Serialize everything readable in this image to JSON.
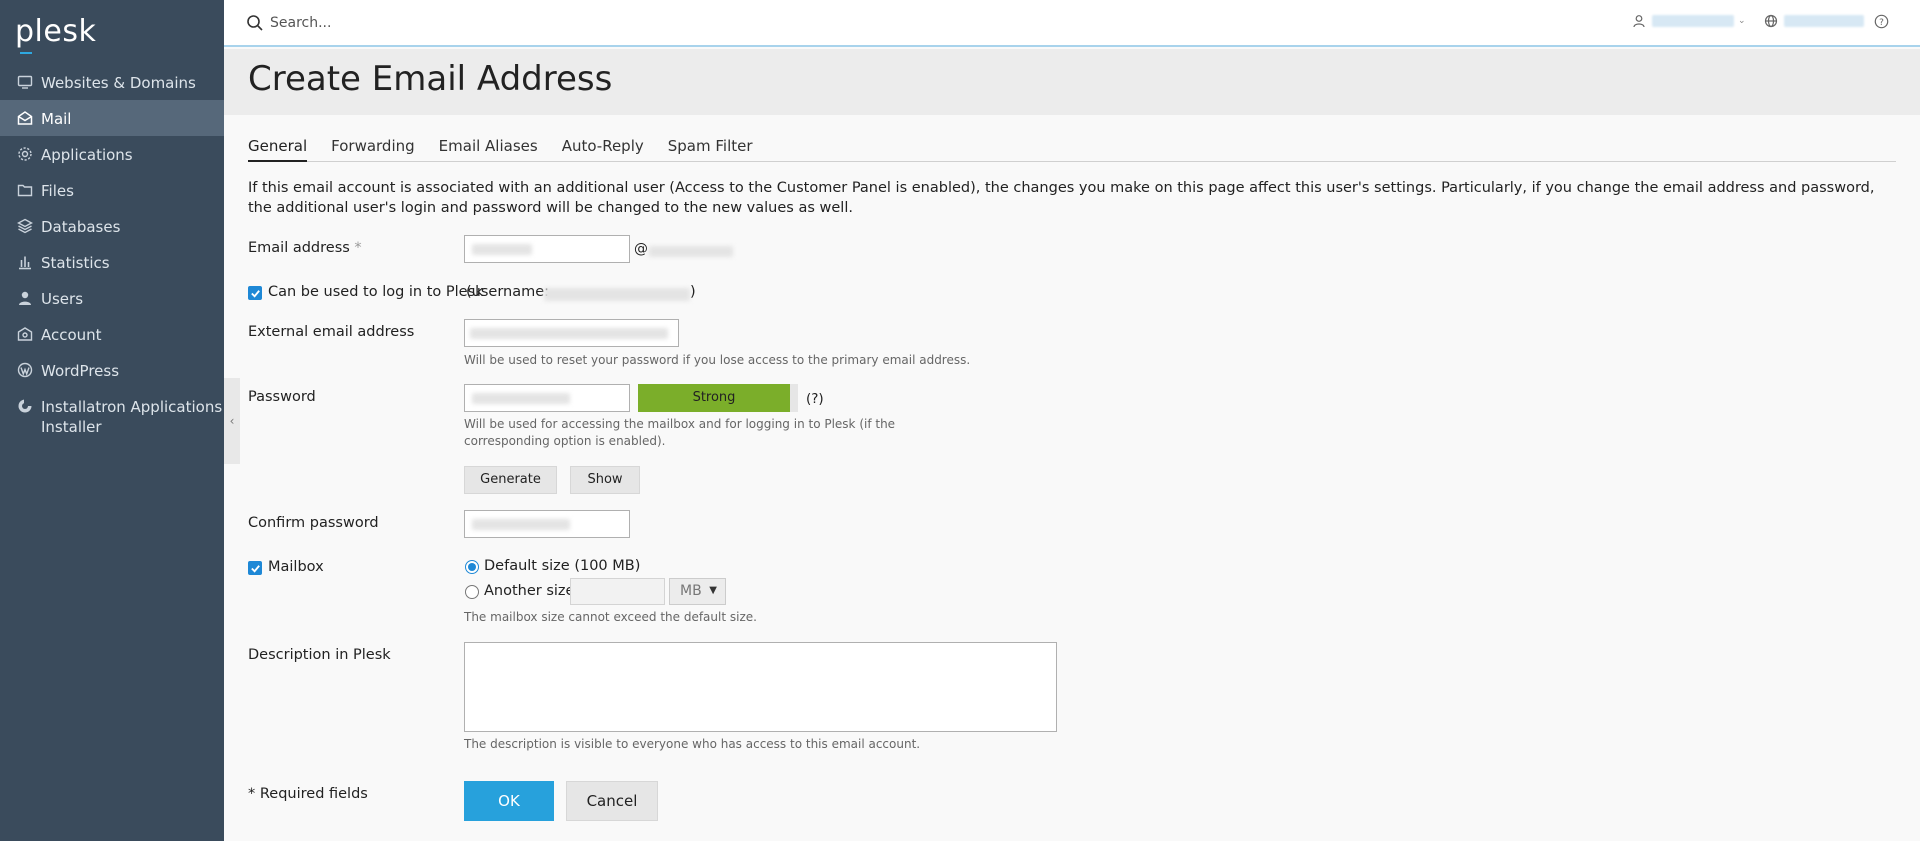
{
  "brand": {
    "name": "plesk",
    "accent": "#2ea8e0"
  },
  "sidebar": {
    "items": [
      {
        "label": "Websites & Domains",
        "icon": "monitor-icon"
      },
      {
        "label": "Mail",
        "icon": "envelope-icon",
        "active": true
      },
      {
        "label": "Applications",
        "icon": "gear-icon"
      },
      {
        "label": "Files",
        "icon": "folder-icon"
      },
      {
        "label": "Databases",
        "icon": "database-icon"
      },
      {
        "label": "Statistics",
        "icon": "bar-chart-icon"
      },
      {
        "label": "Users",
        "icon": "user-icon"
      },
      {
        "label": "Account",
        "icon": "account-icon"
      },
      {
        "label": "WordPress",
        "icon": "wordpress-icon"
      },
      {
        "label": "Installatron Applications Installer",
        "icon": "installatron-icon"
      }
    ],
    "colors": {
      "background": "#3a4b5c",
      "active": "#56687a"
    }
  },
  "topbar": {
    "search_placeholder": "Search...",
    "help_symbol": "?"
  },
  "page": {
    "title": "Create Email Address"
  },
  "tabs": [
    {
      "label": "General",
      "active": true
    },
    {
      "label": "Forwarding"
    },
    {
      "label": "Email Aliases"
    },
    {
      "label": "Auto-Reply"
    },
    {
      "label": "Spam Filter"
    }
  ],
  "info_text": "If this email account is associated with an additional user (Access to the Customer Panel is enabled), the changes you make on this page affect this user's settings. Particularly, if you change the email address and password, the additional user's login and password will be changed to the new values as well.",
  "form": {
    "email_label": "Email address",
    "required_mark": "*",
    "at_sign": "@",
    "login_checkbox_label": "Can be used to log in to Plesk",
    "login_checked": true,
    "username_prefix": "(username:",
    "username_suffix": ")",
    "external_label": "External email address",
    "external_hint": "Will be used to reset your password if you lose access to the primary email address.",
    "password_label": "Password",
    "strength_text": "Strong",
    "strength_color": "#7bae2a",
    "strength_help": "(?)",
    "password_hint": "Will be used for accessing the mailbox and for logging in to Plesk (if the corresponding option is enabled).",
    "generate_label": "Generate",
    "show_label": "Show",
    "confirm_label": "Confirm password",
    "mailbox_label": "Mailbox",
    "mailbox_checked": true,
    "default_size_label": "Default size (100 MB)",
    "another_size_label": "Another size",
    "size_unit": "MB",
    "mailbox_hint": "The mailbox size cannot exceed the default size.",
    "description_label": "Description in Plesk",
    "description_hint": "The description is visible to everyone who has access to this email account.",
    "required_fields_note": "* Required fields",
    "ok_label": "OK",
    "cancel_label": "Cancel",
    "ok_color": "#27a1dc"
  }
}
